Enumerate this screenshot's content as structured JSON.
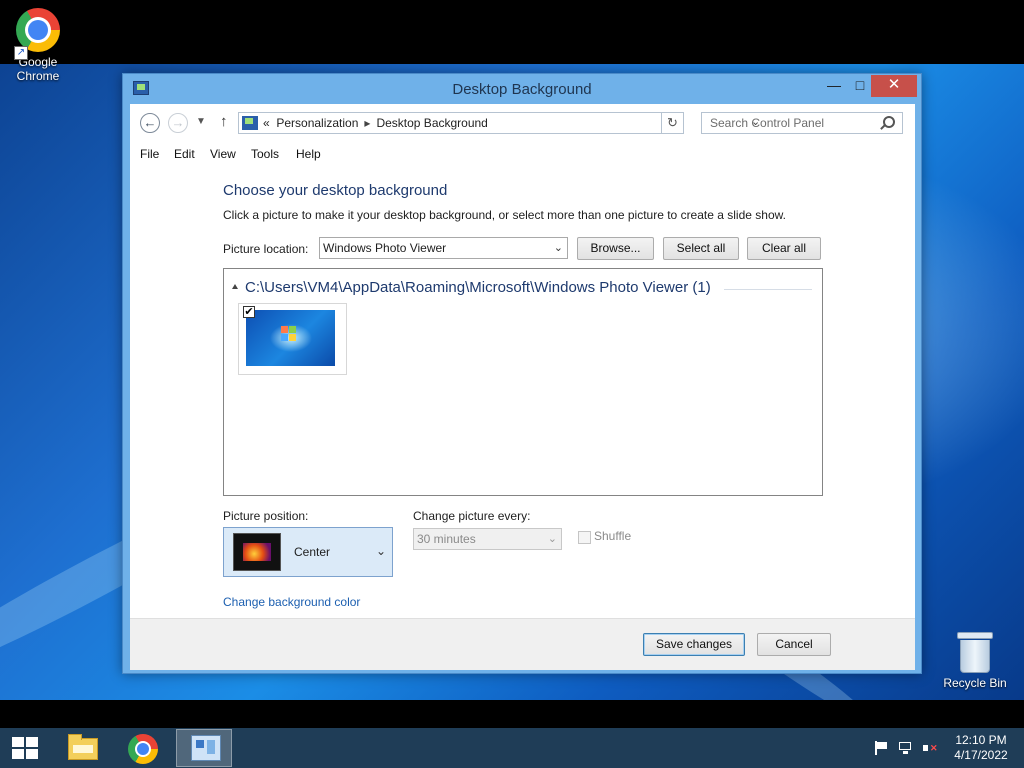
{
  "desktop": {
    "icons": [
      {
        "label_line1": "Google",
        "label_line2": "Chrome"
      },
      {
        "label_line1": "Recycle Bin"
      }
    ]
  },
  "window": {
    "title": "Desktop Background",
    "caption": {
      "minimize": "—",
      "maximize": "□",
      "close": "✕"
    },
    "address": {
      "prefix": "«",
      "crumbs": [
        "Personalization",
        "Desktop Background"
      ],
      "separator": "▸"
    },
    "search": {
      "placeholder": "Search Control Panel"
    },
    "menu": [
      "File",
      "Edit",
      "View",
      "Tools",
      "Help"
    ],
    "heading": "Choose your desktop background",
    "subtext": "Click a picture to make it your desktop background, or select more than one picture to create a slide show.",
    "picture_location": {
      "label": "Picture location:",
      "value": "Windows Photo Viewer"
    },
    "buttons": {
      "browse": "Browse...",
      "select_all": "Select all",
      "clear_all": "Clear all"
    },
    "gallery": {
      "group_title": "C:\\Users\\VM4\\AppData\\Roaming\\Microsoft\\Windows Photo Viewer (1)",
      "items": [
        {
          "checked": true,
          "check_mark": "✔"
        }
      ]
    },
    "picture_position": {
      "label": "Picture position:",
      "value": "Center"
    },
    "change_every": {
      "label": "Change picture every:",
      "value": "30 minutes",
      "disabled": true
    },
    "shuffle": {
      "label": "Shuffle",
      "checked": false,
      "disabled": true
    },
    "background_color_link": "Change background color",
    "footer": {
      "save": "Save changes",
      "cancel": "Cancel"
    }
  },
  "taskbar": {
    "clock": {
      "time": "12:10 PM",
      "date": "4/17/2022"
    },
    "active_item": "control-panel"
  }
}
